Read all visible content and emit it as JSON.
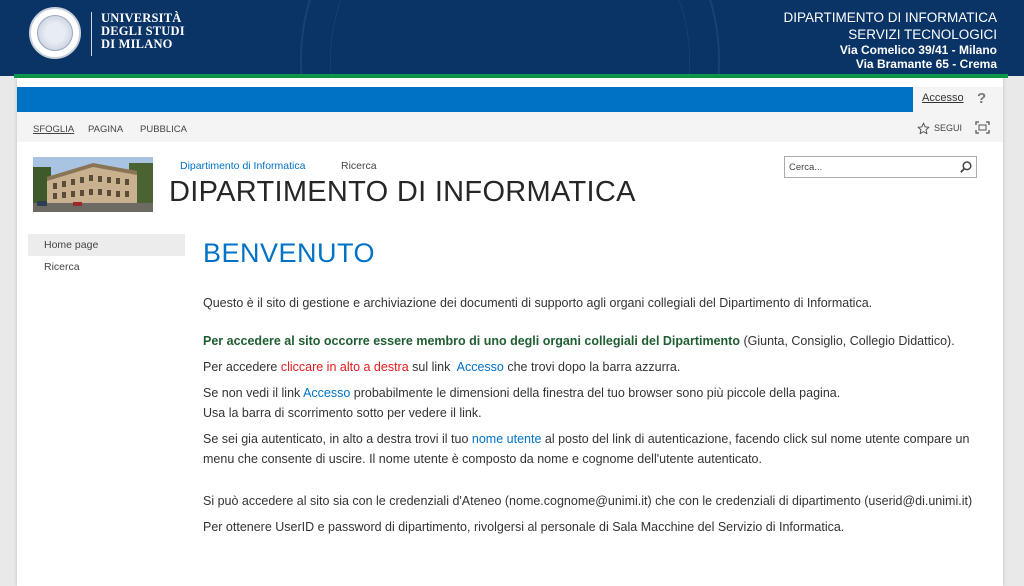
{
  "header": {
    "university_lines": [
      "UNIVERSITÀ",
      "DEGLI STUDI",
      "DI MILANO"
    ],
    "department_lines": [
      "DIPARTIMENTO DI INFORMATICA",
      "SERVIZI TECNOLOGICI",
      "Via Comelico 39/41 - Milano",
      "Via Bramante 65 - Crema"
    ]
  },
  "suitebar": {
    "signin_label": "Accesso",
    "help_label": "?"
  },
  "ribbon": {
    "tabs": [
      "SFOGLIA",
      "PAGINA",
      "PUBBLICA"
    ],
    "follow_label": "SEGUI"
  },
  "site": {
    "top_links": [
      "Dipartimento di Informatica",
      "Ricerca"
    ],
    "title": "DIPARTIMENTO DI INFORMATICA",
    "search_placeholder": "Cerca..."
  },
  "leftnav": {
    "items": [
      "Home page",
      "Ricerca"
    ]
  },
  "content": {
    "heading": "BENVENUTO",
    "intro": "Questo è il sito di gestione e archiviazione dei documenti di supporto agli organi collegiali del Dipartimento di Informatica.",
    "membership": {
      "bold": "Per accedere al sito occorre essere membro di uno degli organi collegiali del Dipartimento",
      "rest": " (Giunta, Consiglio, Collegio Didattico)."
    },
    "access_instr": {
      "pre": "Per accedere ",
      "red": "cliccare in alto a destra",
      "mid": " sul link  ",
      "link": "Accesso",
      "post": " che trovi dopo la barra azzurra."
    },
    "window_note": {
      "pre": "Se non vedi il link ",
      "link": "Accesso",
      "post": " probabilmente le dimensioni della finestra del tuo browser sono più piccole della pagina.",
      "line2": "Usa la barra di scorrimento sotto per vedere il link."
    },
    "authenticated": {
      "pre": "Se sei gia autenticato, in alto a destra trovi il tuo ",
      "link": "nome utente",
      "post": " al posto del link di autenticazione, facendo click sul nome utente compare un",
      "line2": "menu che consente di uscire. Il nome utente è composto da nome e cognome dell'utente autenticato."
    },
    "credentials": "Si può accedere al sito sia con le credenziali d'Ateneo (nome.cognome@unimi.it) che con le credenziali di dipartimento (userid@di.unimi.it)",
    "userid_info": "Per ottenere UserID e password di dipartimento, rivolgersi al personale di Sala Macchine del Servizio di Informatica."
  },
  "colors": {
    "header_bg": "#0a3366",
    "accent_green": "#0d9a4c",
    "suitebar_blue": "#0072c6"
  }
}
